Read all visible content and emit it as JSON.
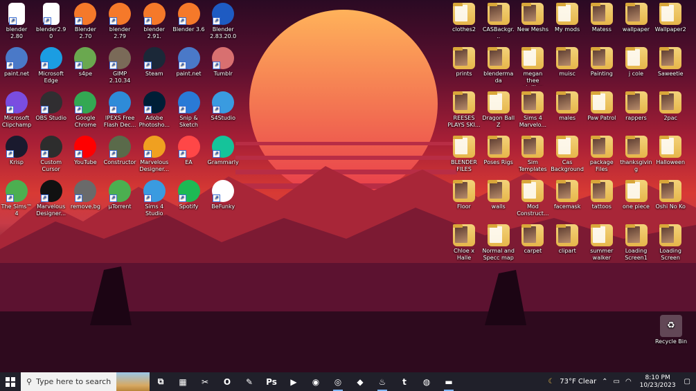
{
  "colors": {
    "sun_top": "#ffb25a",
    "sun_bottom": "#e83b4a",
    "sky_top": "#2a0a23",
    "sea": "#4b0d27",
    "taskbar": "#20202a"
  },
  "desktop_icons": [
    {
      "label": "blender 2.80",
      "icon": "file-icon",
      "color": "#ffffff"
    },
    {
      "label": "blender2.90",
      "icon": "file-icon",
      "color": "#ffffff"
    },
    {
      "label": "Blender 2.70",
      "icon": "blender-icon",
      "color": "#f5792a"
    },
    {
      "label": "blender 2.79",
      "icon": "blender-icon",
      "color": "#f5792a"
    },
    {
      "label": "blender 2.91.",
      "icon": "blender-icon",
      "color": "#f5792a"
    },
    {
      "label": "Blender 3.6",
      "icon": "blender-icon",
      "color": "#f5792a"
    },
    {
      "label": "Blender 2.83.20.0",
      "icon": "blender-icon",
      "color": "#1e5bc2"
    },
    {
      "label": "paint.net",
      "icon": "paintnet-icon",
      "color": "#4a79c8"
    },
    {
      "label": "Microsoft Edge",
      "icon": "edge-icon",
      "color": "#1b9de2"
    },
    {
      "label": "s4pe",
      "icon": "s4pe-icon",
      "color": "#6aa84f"
    },
    {
      "label": "GIMP 2.10.34",
      "icon": "gimp-icon",
      "color": "#7a6a58"
    },
    {
      "label": "Steam",
      "icon": "steam-icon",
      "color": "#1b2838"
    },
    {
      "label": "paint.net",
      "icon": "paintnet-icon",
      "color": "#4a79c8"
    },
    {
      "label": "Tumblr",
      "icon": "tumblr-icon",
      "color": "#d87070"
    },
    {
      "label": "Microsoft Clipchamp",
      "icon": "clipchamp-icon",
      "color": "#7a4de0"
    },
    {
      "label": "OBS Studio",
      "icon": "obs-icon",
      "color": "#302e31"
    },
    {
      "label": "Google Chrome",
      "icon": "chrome-icon",
      "color": "#34a853"
    },
    {
      "label": "IPEXS Free Flash Dec...",
      "icon": "ipexs-icon",
      "color": "#2e8bd8"
    },
    {
      "label": "Adobe Photosho...",
      "icon": "photoshop-icon",
      "color": "#001e36"
    },
    {
      "label": "Snip & Sketch",
      "icon": "snip-icon",
      "color": "#2a7ad6"
    },
    {
      "label": "S4Studio",
      "icon": "s4studio-icon",
      "color": "#3a9be0"
    },
    {
      "label": "Krisp",
      "icon": "krisp-icon",
      "color": "#1a1a2e"
    },
    {
      "label": "Custom Cursor",
      "icon": "cursor-icon",
      "color": "#2d2d2d"
    },
    {
      "label": "YouTube",
      "icon": "youtube-icon",
      "color": "#ff0000"
    },
    {
      "label": "Constructor",
      "icon": "constructor-icon",
      "color": "#5a6a4a"
    },
    {
      "label": "Marvelous Designer...",
      "icon": "marvelous-icon",
      "color": "#f0a020"
    },
    {
      "label": "EA",
      "icon": "ea-icon",
      "color": "#ff4747"
    },
    {
      "label": "Grammarly",
      "icon": "grammarly-icon",
      "color": "#15c39a"
    },
    {
      "label": "The Sims™ 4",
      "icon": "sims-icon",
      "color": "#4caf50"
    },
    {
      "label": "Marvelous Designer...",
      "icon": "marvelous-m-icon",
      "color": "#111111"
    },
    {
      "label": "remove.bg",
      "icon": "removebg-icon",
      "color": "#6a6a6a"
    },
    {
      "label": "µTorrent",
      "icon": "utorrent-icon",
      "color": "#4caf50"
    },
    {
      "label": "Sims 4 Studio",
      "icon": "s4studio-icon",
      "color": "#3a9be0"
    },
    {
      "label": "Spotify",
      "icon": "spotify-icon",
      "color": "#1db954"
    },
    {
      "label": "BeFunky",
      "icon": "befunky-icon",
      "color": "#ffffff"
    }
  ],
  "folders": [
    {
      "label": "clothes2"
    },
    {
      "label": "CASBackgr..."
    },
    {
      "label": "New Meshs"
    },
    {
      "label": "My mods"
    },
    {
      "label": "Matess"
    },
    {
      "label": "wallpaper"
    },
    {
      "label": "Wallpaper2"
    },
    {
      "label": "prints"
    },
    {
      "label": "blendermada"
    },
    {
      "label": "megan thee stallion"
    },
    {
      "label": "muisc"
    },
    {
      "label": "Painting"
    },
    {
      "label": "j cole"
    },
    {
      "label": "Saweetie"
    },
    {
      "label": "REESES PLAYS SKI..."
    },
    {
      "label": "Dragon Ball Z"
    },
    {
      "label": "Sims 4 Marvelo..."
    },
    {
      "label": "males"
    },
    {
      "label": "Paw Patrol"
    },
    {
      "label": "rappers"
    },
    {
      "label": "2pac"
    },
    {
      "label": "BLENDER FILES"
    },
    {
      "label": "Poses Rigs"
    },
    {
      "label": "Sim Templates"
    },
    {
      "label": "Cas Background"
    },
    {
      "label": "package Files"
    },
    {
      "label": "thanksgiving"
    },
    {
      "label": "Halloween"
    },
    {
      "label": "Floor"
    },
    {
      "label": "walls"
    },
    {
      "label": "Mod Construct..."
    },
    {
      "label": "facemask"
    },
    {
      "label": "tattoos"
    },
    {
      "label": "one piece"
    },
    {
      "label": "Oshi No Ko"
    },
    {
      "label": "Chloe x Halle"
    },
    {
      "label": "Normal and Specc map"
    },
    {
      "label": "carpet"
    },
    {
      "label": "clipart"
    },
    {
      "label": "summer walker"
    },
    {
      "label": "Loading Screen1"
    },
    {
      "label": "Loading Screen"
    }
  ],
  "recycle_bin": {
    "label": "Recycle Bin"
  },
  "taskbar": {
    "search_placeholder": "Type here to search",
    "apps": [
      {
        "name": "task-view-icon",
        "glyph": "⧉",
        "active": false
      },
      {
        "name": "store-icon",
        "glyph": "▦",
        "active": false
      },
      {
        "name": "snip-app-icon",
        "glyph": "✂",
        "active": false
      },
      {
        "name": "outlook-icon",
        "glyph": "O",
        "active": false
      },
      {
        "name": "snip-sketch-icon",
        "glyph": "✎",
        "active": false
      },
      {
        "name": "photoshop-app-icon",
        "glyph": "Ps",
        "active": false
      },
      {
        "name": "youtube-app-icon",
        "glyph": "▶",
        "active": false
      },
      {
        "name": "blender-app-icon",
        "glyph": "◉",
        "active": false
      },
      {
        "name": "chrome-app-icon",
        "glyph": "◎",
        "active": true
      },
      {
        "name": "layers-app-icon",
        "glyph": "◆",
        "active": false
      },
      {
        "name": "steam-app-icon",
        "glyph": "♨",
        "active": true
      },
      {
        "name": "tumblr-app-icon",
        "glyph": "t",
        "active": false
      },
      {
        "name": "befunky-app-icon",
        "glyph": "◍",
        "active": false
      },
      {
        "name": "file-explorer-icon",
        "glyph": "▬",
        "active": true
      }
    ],
    "weather": "73°F  Clear",
    "time": "8:10 PM",
    "date": "10/23/2023"
  }
}
